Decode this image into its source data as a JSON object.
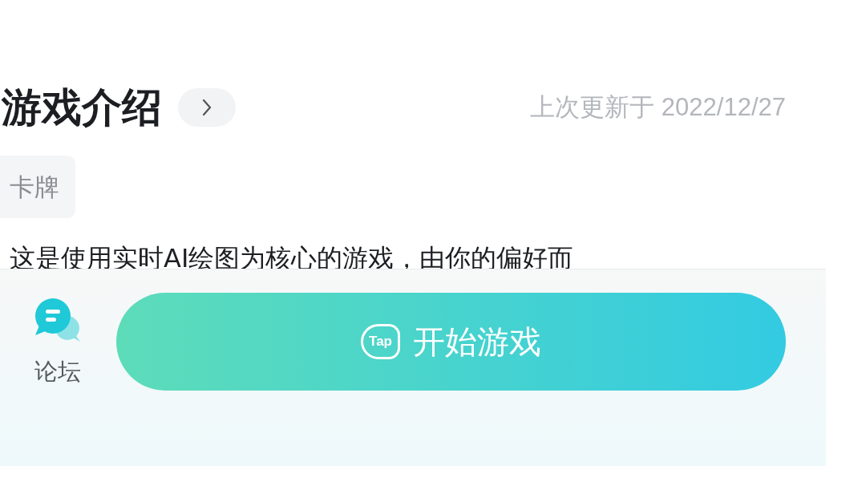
{
  "section": {
    "title": "游戏介绍",
    "updated": "上次更新于 2022/12/27"
  },
  "tags": [
    "卡牌"
  ],
  "description": "这是使用实时AI绘图为核心的游戏，由你的偏好而",
  "bottom_bar": {
    "forum_label": "论坛",
    "play_button": {
      "logo_text": "Tap",
      "label": "开始游戏"
    }
  }
}
